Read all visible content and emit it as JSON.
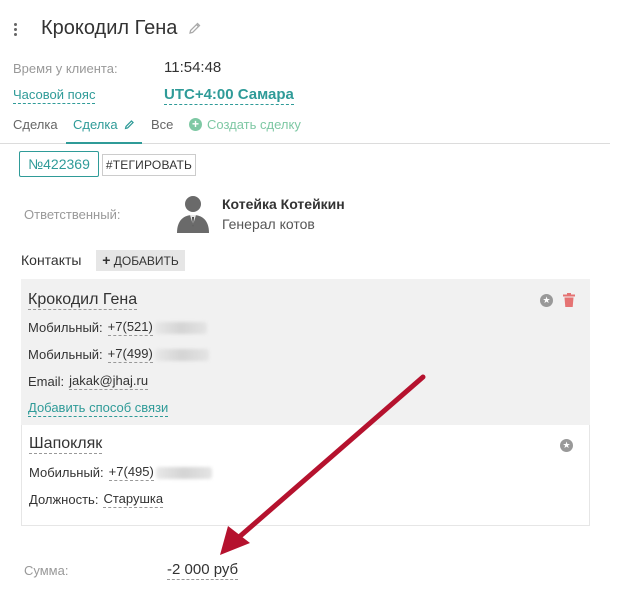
{
  "header": {
    "title": "Крокодил Гена"
  },
  "client_time": {
    "label": "Время у клиента:",
    "value": "11:54:48"
  },
  "timezone": {
    "label": "Часовой пояс",
    "value": "UTC+4:00 Самара"
  },
  "tabs": [
    {
      "label": "Сделка"
    },
    {
      "label": "Сделка"
    },
    {
      "label": "Все"
    },
    {
      "label": "Создать сделку"
    }
  ],
  "deal": {
    "number": "№422369",
    "tag_label": "#ТЕГИРОВАТЬ"
  },
  "responsible": {
    "label": "Ответственный:",
    "name": "Котейка Котейкин",
    "role": "Генерал котов"
  },
  "contacts": {
    "heading": "Контакты",
    "add_label": "ДОБАВИТЬ",
    "items": [
      {
        "name": "Крокодил Гена",
        "rows": [
          {
            "key": "Мобильный:",
            "value": "+7(521)"
          },
          {
            "key": "Мобильный:",
            "value": "+7(499)"
          },
          {
            "key": "Email:",
            "value": "jakak@jhaj.ru"
          }
        ],
        "add_link": "Добавить способ связи"
      },
      {
        "name": "Шапокляк",
        "rows": [
          {
            "key": "Мобильный:",
            "value": "+7(495)"
          },
          {
            "key": "Должность:",
            "value": "Старушка"
          }
        ]
      }
    ]
  },
  "sum": {
    "label": "Сумма:",
    "value": "-2 000 руб"
  },
  "colors": {
    "accent": "#2f9b98",
    "add_green": "#7ec8a4",
    "delete_red": "#e57373",
    "arrow": "#b5122e"
  }
}
